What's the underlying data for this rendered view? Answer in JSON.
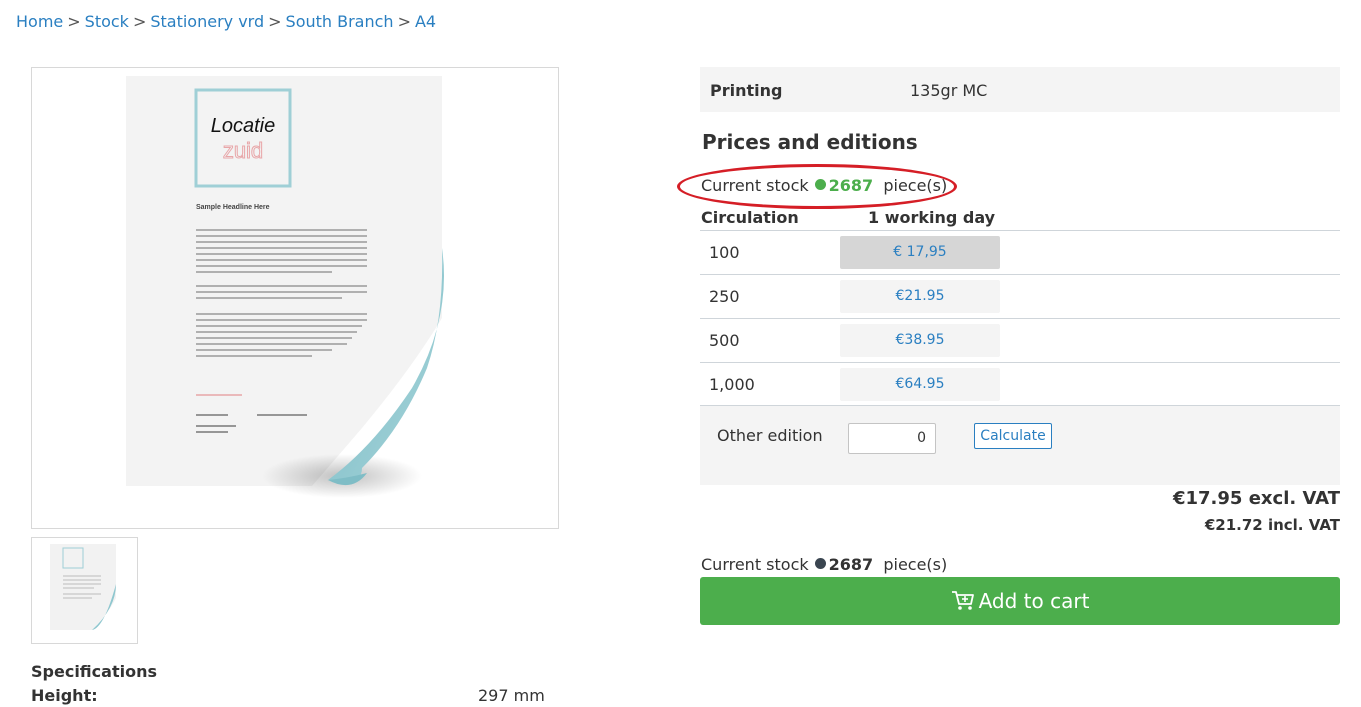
{
  "breadcrumb": {
    "items": [
      "Home",
      "Stock",
      "Stationery vrd",
      "South Branch",
      "A4"
    ],
    "separator": ">"
  },
  "product_image": {
    "logo_line1": "Locatie",
    "logo_line2": "zuid",
    "headline": "Sample Headline Here"
  },
  "specifications": {
    "title": "Specifications",
    "height_label": "Height:",
    "height_value": "297 mm"
  },
  "printing": {
    "label": "Printing",
    "value": "135gr MC"
  },
  "prices": {
    "title": "Prices and editions",
    "stock_label": "Current stock",
    "stock_count": "2687",
    "stock_unit": "piece(s)",
    "col_circulation": "Circulation",
    "col_delivery": "1 working day",
    "rows": [
      {
        "qty": "100",
        "price": "€ 17,95",
        "selected": true
      },
      {
        "qty": "250",
        "price": "€21.95",
        "selected": false
      },
      {
        "qty": "500",
        "price": "€38.95",
        "selected": false
      },
      {
        "qty": "1,000",
        "price": "€64.95",
        "selected": false
      }
    ],
    "other_label": "Other edition",
    "other_value": "0",
    "calculate_label": "Calculate"
  },
  "totals": {
    "excl": "€17.95 excl. VAT",
    "incl": "€21.72 incl. VAT"
  },
  "stock_bottom": {
    "label": "Current stock",
    "count": "2687",
    "unit": "piece(s)"
  },
  "cart": {
    "label": "Add to cart",
    "icon": "cart-icon"
  },
  "colors": {
    "link": "#2a7fc1",
    "green": "#4cae4c",
    "highlight": "#d51e26"
  }
}
